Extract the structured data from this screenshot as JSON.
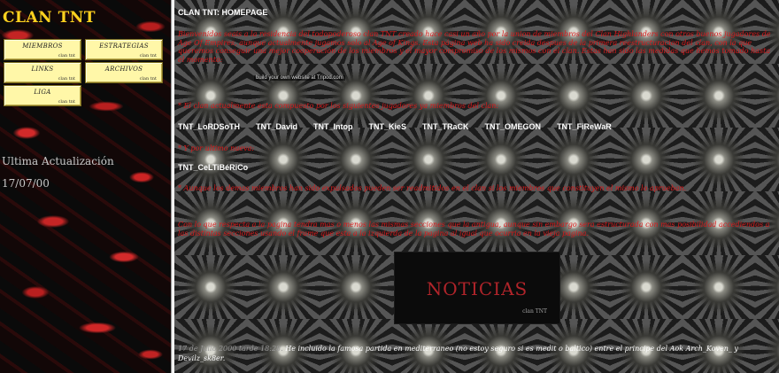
{
  "sidebar": {
    "title": "CLAN TNT",
    "buttons": [
      {
        "label": "MIEMBROS",
        "sub": "clan tnt"
      },
      {
        "label": "ESTRATEGIAS",
        "sub": "clan tnt"
      },
      {
        "label": "LINKS",
        "sub": "clan tnt"
      },
      {
        "label": "ARCHIVOS",
        "sub": "clan tnt"
      },
      {
        "label": "LIGA",
        "sub": "clan tnt"
      }
    ],
    "update_label": "Ultima Actualización",
    "update_date": "17/07/00"
  },
  "main": {
    "title": "CLAN TNT: HOMEPAGE",
    "intro": "Bienvenidos seais a la residencia del todopoderoso clan TNT creado hace casi un año por la union de miembros del Clan Highlanders con otros buenos jugadores de Age Of Empires, aunque actualmente jugamos solo al Age of Kings. Esta página web ha sido creida despues de la primera reestructuracion del clan, con la que queremos conseguir una mejor cooperación de los miembros y el mayor compromiso de los mismos con el clan. Estas han sido las medidas que hemos tomado hasta el momento:",
    "host_link": "build your own website at Tripod.com",
    "members_intro": "* El clan actualmente esta compuesto por los siguientes jugadores ya miembros del clan:",
    "members": [
      "TNT_LoRDSoTH",
      "TNT_David",
      "TNT_Intop",
      "TNT_KieS",
      "TNT_TRaCK",
      "TNT_OMEGON",
      "TNT_FiReWaR"
    ],
    "new_member_intro": "* Y por ultimo nueva:",
    "new_member": "TNT_CeLTiBéRiCo",
    "expelled_text": "* Aunque los demas miembros han sido expulsados pueden ser readmitidos en el clan si los miembros que constituyen el mismo lo aprueban.",
    "layout_text": "Con lo que respecta a la pagina tendra mas o menos las mismas secciones que la antigua, aunque sin embargo sera estructurada con mas posibilidad accediendos a las distintas secciones usando el frame que esta a la izquierda de la pagina al igual que ocurria en la vieja pagina.",
    "news": {
      "title": "NOTICIAS",
      "subtitle": "clan TNT",
      "entry_date": "17 de Julio 2000 tarde 18:28.",
      "entry_text": "He incluido la famosa partida en mediterraneo (no estoy seguro si es medit o baltico) entre el principe del Aok Arch_Koven_ y Devilz_sk8er."
    }
  }
}
